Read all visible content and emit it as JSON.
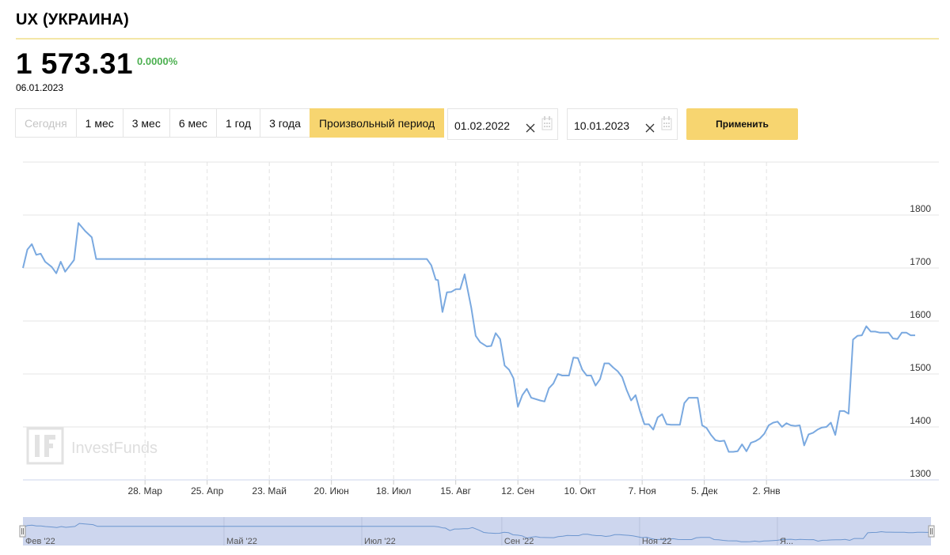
{
  "header": {
    "title": "UX (УКРАИНА)"
  },
  "quote": {
    "price": "1 573.31",
    "change": "0.0000%",
    "date": "06.01.2023"
  },
  "periods": [
    {
      "label": "Сегодня",
      "state": "disabled"
    },
    {
      "label": "1 мес",
      "state": "normal"
    },
    {
      "label": "3 мес",
      "state": "normal"
    },
    {
      "label": "6 мес",
      "state": "normal"
    },
    {
      "label": "1 год",
      "state": "normal"
    },
    {
      "label": "3 года",
      "state": "normal"
    },
    {
      "label": "Произвольный период",
      "state": "active"
    }
  ],
  "range": {
    "from": "01.02.2022",
    "to": "10.01.2023",
    "apply_label": "Применить"
  },
  "icons": {
    "clear": "close-icon",
    "calendar": "calendar-icon"
  },
  "colors": {
    "accent": "#f7d570",
    "line": "#7aa9e0",
    "change": "#4cb050",
    "navigator": "#cdd6ee"
  },
  "watermark": "InvestFunds",
  "chart_data": {
    "type": "line",
    "x_start": "2022-02-01",
    "x_end": "2023-01-10",
    "ylim": [
      1300,
      1900
    ],
    "y_ticks": [
      1300,
      1400,
      1500,
      1600,
      1700,
      1800
    ],
    "x_ticks": [
      {
        "date": "2022-03-28",
        "label": "28. Мар"
      },
      {
        "date": "2022-04-25",
        "label": "25. Апр"
      },
      {
        "date": "2022-05-23",
        "label": "23. Май"
      },
      {
        "date": "2022-06-20",
        "label": "20. Июн"
      },
      {
        "date": "2022-07-18",
        "label": "18. Июл"
      },
      {
        "date": "2022-08-15",
        "label": "15. Авг"
      },
      {
        "date": "2022-09-12",
        "label": "12. Сен"
      },
      {
        "date": "2022-10-10",
        "label": "10. Окт"
      },
      {
        "date": "2022-11-07",
        "label": "7. Ноя"
      },
      {
        "date": "2022-12-05",
        "label": "5. Дек"
      },
      {
        "date": "2023-01-02",
        "label": "2. Янв"
      }
    ],
    "grid": true,
    "series": [
      {
        "points": [
          [
            "2022-02-01",
            1700
          ],
          [
            "2022-02-03",
            1735
          ],
          [
            "2022-02-05",
            1745
          ],
          [
            "2022-02-07",
            1725
          ],
          [
            "2022-02-09",
            1727
          ],
          [
            "2022-02-11",
            1712
          ],
          [
            "2022-02-14",
            1702
          ],
          [
            "2022-02-16",
            1690
          ],
          [
            "2022-02-18",
            1712
          ],
          [
            "2022-02-20",
            1693
          ],
          [
            "2022-02-24",
            1715
          ],
          [
            "2022-02-26",
            1785
          ],
          [
            "2022-03-01",
            1770
          ],
          [
            "2022-03-04",
            1758
          ],
          [
            "2022-03-06",
            1717
          ],
          [
            "2022-08-02",
            1717
          ],
          [
            "2022-08-04",
            1705
          ],
          [
            "2022-08-06",
            1678
          ],
          [
            "2022-08-07",
            1677
          ],
          [
            "2022-08-09",
            1617
          ],
          [
            "2022-08-11",
            1654
          ],
          [
            "2022-08-13",
            1655
          ],
          [
            "2022-08-15",
            1660
          ],
          [
            "2022-08-17",
            1660
          ],
          [
            "2022-08-19",
            1688
          ],
          [
            "2022-08-22",
            1625
          ],
          [
            "2022-08-24",
            1572
          ],
          [
            "2022-08-26",
            1560
          ],
          [
            "2022-08-29",
            1552
          ],
          [
            "2022-08-31",
            1553
          ],
          [
            "2022-09-02",
            1577
          ],
          [
            "2022-09-04",
            1566
          ],
          [
            "2022-09-06",
            1516
          ],
          [
            "2022-09-08",
            1508
          ],
          [
            "2022-09-10",
            1492
          ],
          [
            "2022-09-12",
            1438
          ],
          [
            "2022-09-14",
            1460
          ],
          [
            "2022-09-16",
            1472
          ],
          [
            "2022-09-18",
            1455
          ],
          [
            "2022-09-22",
            1450
          ],
          [
            "2022-09-24",
            1448
          ],
          [
            "2022-09-26",
            1473
          ],
          [
            "2022-09-28",
            1482
          ],
          [
            "2022-09-30",
            1500
          ],
          [
            "2022-10-02",
            1497
          ],
          [
            "2022-10-05",
            1497
          ],
          [
            "2022-10-07",
            1531
          ],
          [
            "2022-10-09",
            1530
          ],
          [
            "2022-10-11",
            1508
          ],
          [
            "2022-10-13",
            1497
          ],
          [
            "2022-10-15",
            1497
          ],
          [
            "2022-10-17",
            1478
          ],
          [
            "2022-10-19",
            1490
          ],
          [
            "2022-10-21",
            1520
          ],
          [
            "2022-10-23",
            1520
          ],
          [
            "2022-10-25",
            1512
          ],
          [
            "2022-10-27",
            1505
          ],
          [
            "2022-10-29",
            1494
          ],
          [
            "2022-10-31",
            1470
          ],
          [
            "2022-11-02",
            1450
          ],
          [
            "2022-11-04",
            1460
          ],
          [
            "2022-11-06",
            1430
          ],
          [
            "2022-11-08",
            1405
          ],
          [
            "2022-11-10",
            1405
          ],
          [
            "2022-11-12",
            1395
          ],
          [
            "2022-11-14",
            1418
          ],
          [
            "2022-11-16",
            1424
          ],
          [
            "2022-11-18",
            1405
          ],
          [
            "2022-11-20",
            1404
          ],
          [
            "2022-11-24",
            1404
          ],
          [
            "2022-11-26",
            1445
          ],
          [
            "2022-11-28",
            1455
          ],
          [
            "2022-12-02",
            1455
          ],
          [
            "2022-12-04",
            1403
          ],
          [
            "2022-12-06",
            1398
          ],
          [
            "2022-12-08",
            1385
          ],
          [
            "2022-12-10",
            1375
          ],
          [
            "2022-12-12",
            1373
          ],
          [
            "2022-12-14",
            1374
          ],
          [
            "2022-12-16",
            1353
          ],
          [
            "2022-12-18",
            1353
          ],
          [
            "2022-12-20",
            1354
          ],
          [
            "2022-12-22",
            1367
          ],
          [
            "2022-12-24",
            1354
          ],
          [
            "2022-12-26",
            1370
          ],
          [
            "2022-12-28",
            1373
          ],
          [
            "2022-12-30",
            1378
          ],
          [
            "2023-01-01",
            1387
          ],
          [
            "2023-01-03",
            1403
          ],
          [
            "2023-01-05",
            1408
          ],
          [
            "2023-01-07",
            1410
          ],
          [
            "2023-01-09",
            1400
          ],
          [
            "2023-01-11",
            1407
          ],
          [
            "2023-01-13",
            1403
          ],
          [
            "2023-01-15",
            1402
          ],
          [
            "2023-01-17",
            1403
          ],
          [
            "2023-01-19",
            1365
          ],
          [
            "2023-01-21",
            1386
          ],
          [
            "2023-01-23",
            1389
          ],
          [
            "2023-01-25",
            1395
          ],
          [
            "2023-01-27",
            1399
          ],
          [
            "2023-01-29",
            1400
          ],
          [
            "2023-01-31",
            1408
          ],
          [
            "2023-02-02",
            1385
          ],
          [
            "2023-02-04",
            1430
          ],
          [
            "2023-02-06",
            1430
          ],
          [
            "2023-02-08",
            1425
          ],
          [
            "2023-02-10",
            1565
          ],
          [
            "2023-02-12",
            1572
          ],
          [
            "2023-02-14",
            1573
          ],
          [
            "2023-02-16",
            1590
          ],
          [
            "2023-02-18",
            1580
          ],
          [
            "2023-02-20",
            1580
          ],
          [
            "2023-02-22",
            1578
          ],
          [
            "2023-02-24",
            1578
          ],
          [
            "2023-02-26",
            1578
          ],
          [
            "2023-02-28",
            1567
          ],
          [
            "2023-03-02",
            1566
          ],
          [
            "2023-03-04",
            1578
          ],
          [
            "2023-03-06",
            1578
          ],
          [
            "2023-03-08",
            1573
          ],
          [
            "2023-03-10",
            1573
          ]
        ]
      }
    ]
  },
  "navigator": {
    "labels": [
      "Фев '22",
      "Май '22",
      "Июл '22",
      "Сен '22",
      "Ноя '22",
      "Я..."
    ]
  }
}
